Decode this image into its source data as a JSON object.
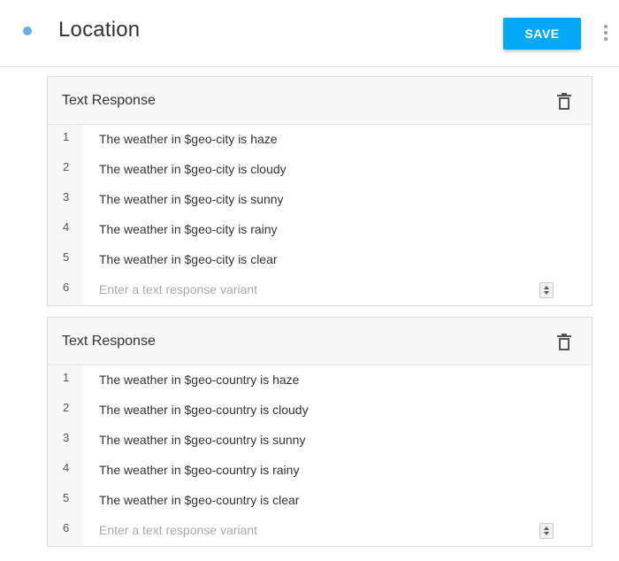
{
  "header": {
    "title": "Location",
    "save_label": "SAVE",
    "status_dot_color": "#6aaee8",
    "save_color": "#03a9f4"
  },
  "responses": [
    {
      "title": "Text Response",
      "rows": [
        {
          "num": "1",
          "text": "The weather in $geo-city is haze"
        },
        {
          "num": "2",
          "text": "The weather in $geo-city is cloudy"
        },
        {
          "num": "3",
          "text": "The weather in $geo-city is sunny"
        },
        {
          "num": "4",
          "text": "The weather in $geo-city is rainy"
        },
        {
          "num": "5",
          "text": "The weather in $geo-city is clear"
        }
      ],
      "new_row": {
        "num": "6",
        "placeholder": "Enter a text response variant",
        "value": ""
      }
    },
    {
      "title": "Text Response",
      "rows": [
        {
          "num": "1",
          "text": "The weather in $geo-country is haze"
        },
        {
          "num": "2",
          "text": "The weather in $geo-country is cloudy"
        },
        {
          "num": "3",
          "text": "The weather in $geo-country is sunny"
        },
        {
          "num": "4",
          "text": "The weather in $geo-country is rainy"
        },
        {
          "num": "5",
          "text": "The weather in $geo-country is clear"
        }
      ],
      "new_row": {
        "num": "6",
        "placeholder": "Enter a text response variant",
        "value": ""
      }
    }
  ]
}
